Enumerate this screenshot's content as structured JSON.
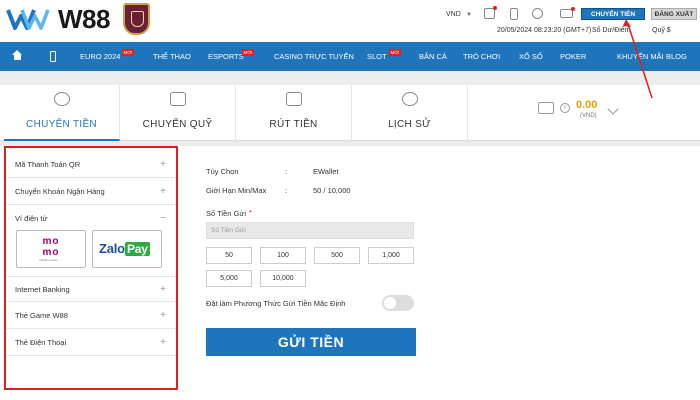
{
  "header": {
    "brand": "W88",
    "currency": "VND",
    "deposit_button": "CHUYỂN TIỀN",
    "logout_button": "ĐĂNG XUẤT",
    "datetime": "20/05/2024 08:23:20 (GMT+7)",
    "balance_label": "Số Dư/Điểm",
    "fund_label": "Quỹ $"
  },
  "nav": {
    "items": [
      {
        "label": "EURO 2024",
        "badge": "MỚI"
      },
      {
        "label": "THỂ THAO"
      },
      {
        "label": "ESPORTS",
        "badge": "MỚI"
      },
      {
        "label": "CASINO TRỰC TUYẾN"
      },
      {
        "label": "SLOT",
        "badge": "MỚI"
      },
      {
        "label": "BẮN CÁ"
      },
      {
        "label": "TRÒ CHƠI"
      },
      {
        "label": "XỔ SỐ"
      },
      {
        "label": "POKER"
      },
      {
        "label": "KHUYẾN MÃI"
      },
      {
        "label": "BLOG"
      }
    ]
  },
  "tabs": [
    {
      "label": "CHUYỂN TIỀN",
      "icon": "piggy-bank-icon"
    },
    {
      "label": "CHUYỂN QUỸ",
      "icon": "transfer-icon"
    },
    {
      "label": "RÚT TIỀN",
      "icon": "withdraw-icon"
    },
    {
      "label": "LỊCH SỬ",
      "icon": "history-icon"
    }
  ],
  "wallet": {
    "amount": "0.00",
    "unit": "(VND)"
  },
  "sidebar": {
    "items": [
      {
        "label": "Mã Thanh Toán QR"
      },
      {
        "label": "Chuyển Khoản Ngân Hàng"
      },
      {
        "label": "Ví điện tử"
      },
      {
        "label": "Internet Banking"
      },
      {
        "label": "Thẻ Game W88"
      },
      {
        "label": "Thẻ Điện Thoại"
      }
    ],
    "wallets": {
      "momo": "mo mo",
      "momo_sub": "mobile money",
      "zalo": "Zalo",
      "zalo_pay": "Pay"
    }
  },
  "form": {
    "option_label": "Tùy Chọn",
    "option_value": "EWallet",
    "limit_label": "Giới Hạn Min/Max",
    "limit_value": "50 / 10,000",
    "amount_label": "Số Tiền Gửi",
    "amount_required": "*",
    "amount_placeholder": "Số Tiền Gửi",
    "amounts": [
      "50",
      "100",
      "500",
      "1,000",
      "5,000",
      "10,000"
    ],
    "default_label": "Đặt làm Phương Thức Gửi Tiền Mặc Định",
    "submit": "GỬI TIỀN"
  },
  "colors": {
    "primary": "#1f75bb",
    "highlight": "#e02020",
    "amount": "#e2a000"
  }
}
